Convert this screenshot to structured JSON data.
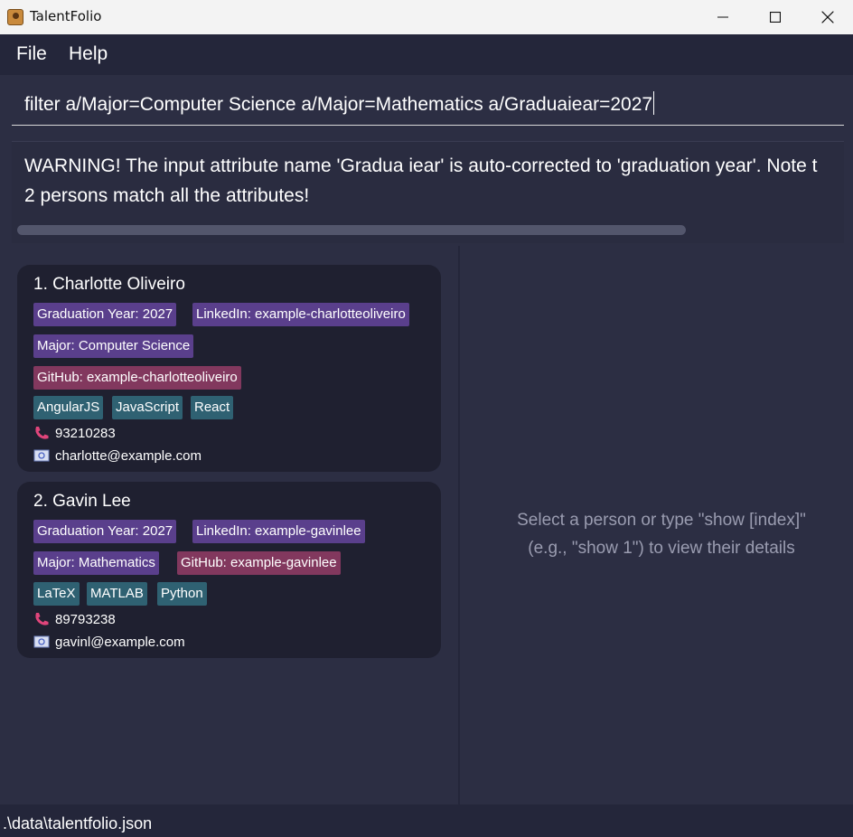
{
  "window": {
    "title": "TalentFolio"
  },
  "menu": {
    "file": "File",
    "help": "Help"
  },
  "command": {
    "value": "filter a/Major=Computer Science a/Major=Mathematics a/Graduaiear=2027"
  },
  "result": {
    "line1": "WARNING! The input attribute name 'Gradua iear' is auto-corrected to 'graduation year'. Note t",
    "line2": "2 persons match all the attributes!"
  },
  "persons": [
    {
      "name": "1. Charlotte Oliveiro",
      "tags": {
        "grad": "Graduation Year: 2027",
        "linkedin": "LinkedIn: example-charlotteoliveiro",
        "major": "Major: Computer Science",
        "github": "GitHub: example-charlotteoliveiro",
        "skills": [
          "AngularJS",
          "JavaScript",
          "React"
        ]
      },
      "phone": "93210283",
      "email": "charlotte@example.com"
    },
    {
      "name": "2. Gavin Lee",
      "tags": {
        "grad": "Graduation Year: 2027",
        "linkedin": "LinkedIn: example-gavinlee",
        "major": "Major: Mathematics",
        "github": "GitHub: example-gavinlee",
        "skills": [
          "LaTeX",
          "MATLAB",
          "Python"
        ]
      },
      "phone": "89793238",
      "email": "gavinl@example.com"
    }
  ],
  "detail": {
    "line1": "Select a person or type \"show [index]\"",
    "line2": "(e.g., \"show 1\") to view their details"
  },
  "status": {
    "file_path": ".\\data\\talentfolio.json"
  },
  "colors": {
    "background": "#2c2e43",
    "card": "#1f2030",
    "tag_purple": "#5a3f8c",
    "tag_pink": "#82385e",
    "tag_teal": "#2f6172",
    "phone_icon": "#e0457b"
  },
  "icons": {
    "phone": "phone-icon",
    "email": "email-icon",
    "app": "app-icon"
  }
}
